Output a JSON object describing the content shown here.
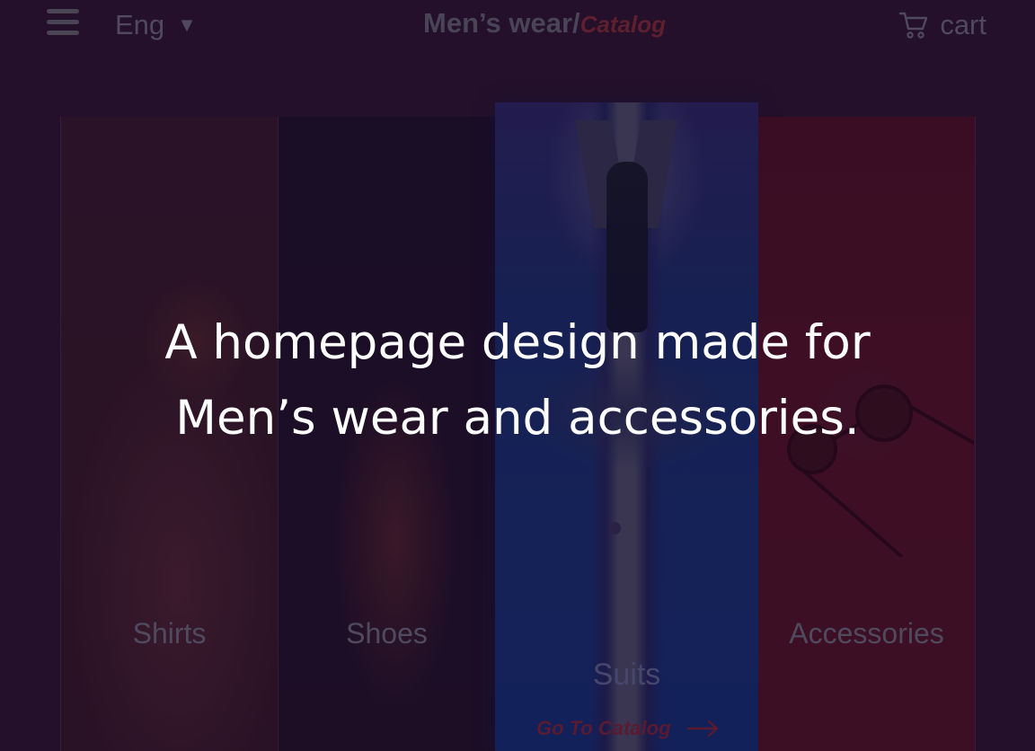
{
  "header": {
    "menu_icon": "hamburger-menu-icon",
    "language": "Eng",
    "language_chevron": "▼",
    "brand_main": "Men’s wear/",
    "brand_sub": "Catalog",
    "cart_icon": "cart-icon",
    "cart_label": "cart"
  },
  "hero": {
    "line1": "A homepage design made for",
    "line2": "Men’s wear and accessories."
  },
  "categories": [
    {
      "label": "Shirts"
    },
    {
      "label": "Shoes"
    },
    {
      "label": "Suits",
      "cta": "Go To Catalog",
      "cta_icon": "arrow-right-icon"
    },
    {
      "label": "Accessories"
    }
  ],
  "colors": {
    "background": "#24102a",
    "accent": "#5a1a30",
    "headline": "#ffffff"
  }
}
